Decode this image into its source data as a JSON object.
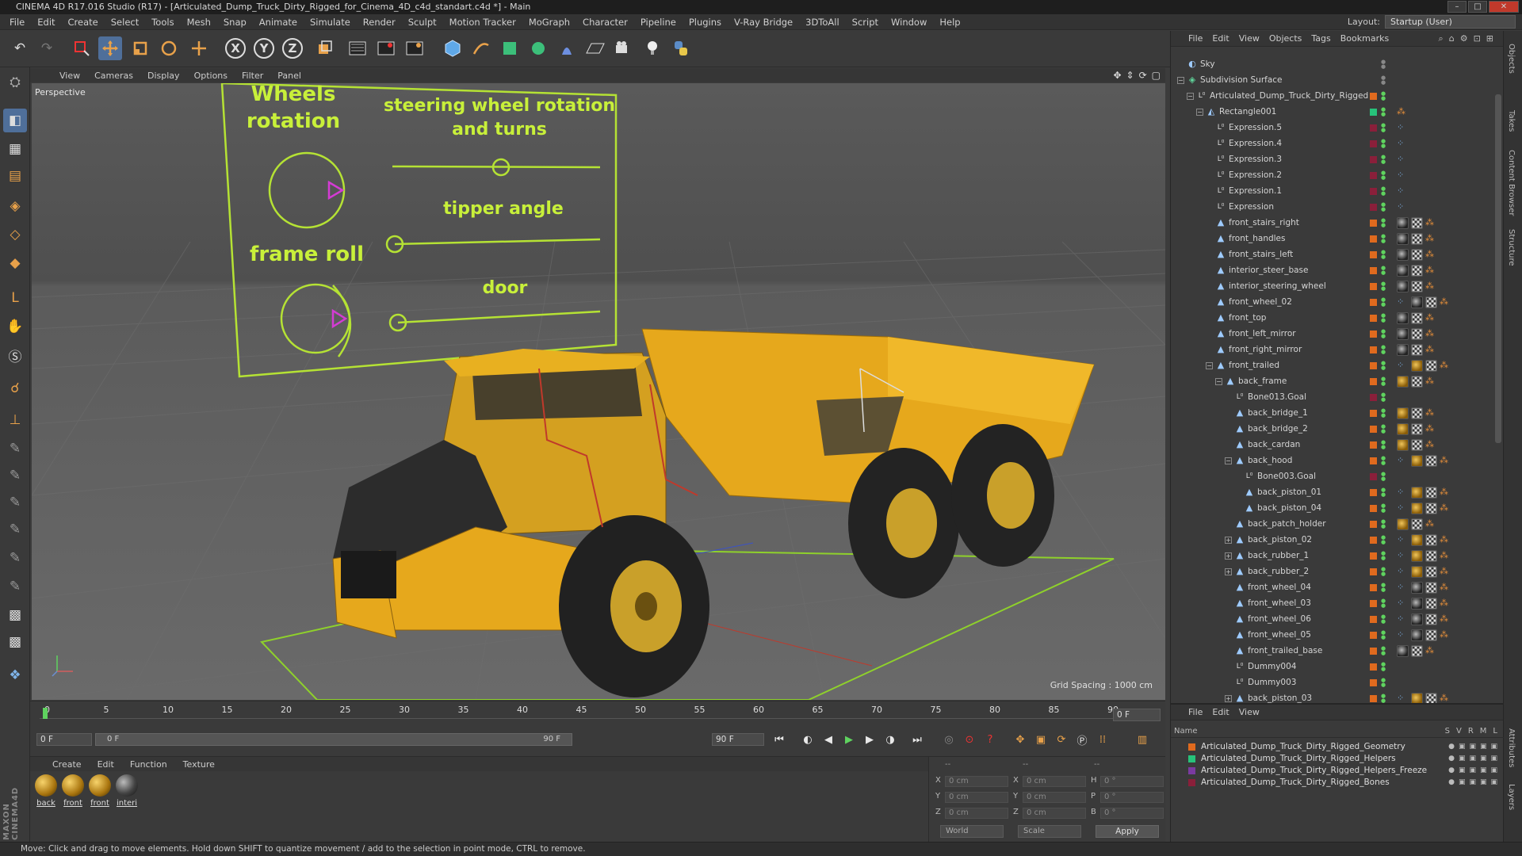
{
  "window": {
    "title": "CINEMA 4D R17.016 Studio (R17) - [Articulated_Dump_Truck_Dirty_Rigged_for_Cinema_4D_c4d_standart.c4d *] - Main",
    "layout_label": "Layout:",
    "layout_value": "Startup (User)"
  },
  "menubar": [
    "File",
    "Edit",
    "Create",
    "Select",
    "Tools",
    "Mesh",
    "Snap",
    "Animate",
    "Simulate",
    "Render",
    "Sculpt",
    "Motion Tracker",
    "MoGraph",
    "Character",
    "Pipeline",
    "Plugins",
    "V-Ray Bridge",
    "3DToAll",
    "Script",
    "Window",
    "Help"
  ],
  "viewport": {
    "menu": [
      "View",
      "Cameras",
      "Display",
      "Options",
      "Filter",
      "Panel"
    ],
    "label": "Perspective",
    "grid_spacing": "Grid Spacing : 1000 cm",
    "rig_labels": {
      "wheels": "Wheels",
      "rotation": "rotation",
      "steering1": "steering wheel rotation",
      "steering2": "and turns",
      "tipper": "tipper angle",
      "frame_roll": "frame roll",
      "door": "door"
    }
  },
  "timeline": {
    "ticks": [
      "0",
      "5",
      "10",
      "15",
      "20",
      "25",
      "30",
      "35",
      "40",
      "45",
      "50",
      "55",
      "60",
      "65",
      "70",
      "75",
      "80",
      "85",
      "90"
    ],
    "current_frame": "0 F",
    "start_field": "0 F",
    "range_start": "0 F",
    "range_end": "90 F",
    "end_field": "90 F"
  },
  "materials": {
    "menu": [
      "Create",
      "Edit",
      "Function",
      "Texture"
    ],
    "items": [
      {
        "label": "back",
        "style": "gold"
      },
      {
        "label": "front",
        "style": "gold"
      },
      {
        "label": "front",
        "style": "gold"
      },
      {
        "label": "interi",
        "style": "dark"
      }
    ]
  },
  "coordinates": {
    "header1": "--",
    "header2": "--",
    "header3": "--",
    "rows": [
      {
        "a_label": "X",
        "a_val": "0 cm",
        "b_label": "X",
        "b_val": "0 cm",
        "c_label": "H",
        "c_val": "0 °"
      },
      {
        "a_label": "Y",
        "a_val": "0 cm",
        "b_label": "Y",
        "b_val": "0 cm",
        "c_label": "P",
        "c_val": "0 °"
      },
      {
        "a_label": "Z",
        "a_val": "0 cm",
        "b_label": "Z",
        "b_val": "0 cm",
        "c_label": "B",
        "c_val": "0 °"
      }
    ],
    "world": "World",
    "scale": "Scale",
    "apply": "Apply"
  },
  "status": "Move: Click and drag to move elements. Hold down SHIFT to quantize movement / add to the selection in point mode, CTRL to remove.",
  "object_manager": {
    "menu": [
      "File",
      "Edit",
      "View",
      "Objects",
      "Tags",
      "Bookmarks"
    ],
    "rows": [
      {
        "name": "Sky",
        "icon": "sky-icon",
        "depth": 0,
        "expand": "",
        "color": "",
        "tags": []
      },
      {
        "name": "Subdivision Surface",
        "icon": "subdivision-icon",
        "depth": 0,
        "expand": "-",
        "color": "",
        "tags": []
      },
      {
        "name": "Articulated_Dump_Truck_Dirty_Rigged",
        "icon": "null-icon",
        "depth": 1,
        "expand": "-",
        "color": "#e06a1e",
        "tags": []
      },
      {
        "name": "Rectangle001",
        "icon": "spline-icon",
        "depth": 2,
        "expand": "-",
        "color": "#27c27a",
        "tags": [
          "or"
        ]
      },
      {
        "name": "Expression.5",
        "icon": "null-icon",
        "depth": 3,
        "expand": "",
        "color": "#8a1f3a",
        "tags": [
          "xp"
        ]
      },
      {
        "name": "Expression.4",
        "icon": "null-icon",
        "depth": 3,
        "expand": "",
        "color": "#8a1f3a",
        "tags": [
          "xp"
        ]
      },
      {
        "name": "Expression.3",
        "icon": "null-icon",
        "depth": 3,
        "expand": "",
        "color": "#8a1f3a",
        "tags": [
          "xp"
        ]
      },
      {
        "name": "Expression.2",
        "icon": "null-icon",
        "depth": 3,
        "expand": "",
        "color": "#8a1f3a",
        "tags": [
          "xp"
        ]
      },
      {
        "name": "Expression.1",
        "icon": "null-icon",
        "depth": 3,
        "expand": "",
        "color": "#8a1f3a",
        "tags": [
          "xp"
        ]
      },
      {
        "name": "Expression",
        "icon": "null-icon",
        "depth": 3,
        "expand": "",
        "color": "#8a1f3a",
        "tags": [
          "xp"
        ]
      },
      {
        "name": "front_stairs_right",
        "icon": "polygon-icon",
        "depth": 3,
        "expand": "",
        "color": "#e06a1e",
        "tags": [
          "dk",
          "chk",
          "or"
        ]
      },
      {
        "name": "front_handles",
        "icon": "polygon-icon",
        "depth": 3,
        "expand": "",
        "color": "#e06a1e",
        "tags": [
          "dk",
          "chk",
          "or"
        ]
      },
      {
        "name": "front_stairs_left",
        "icon": "polygon-icon",
        "depth": 3,
        "expand": "",
        "color": "#e06a1e",
        "tags": [
          "dk",
          "chk",
          "or"
        ]
      },
      {
        "name": "interior_steer_base",
        "icon": "polygon-icon",
        "depth": 3,
        "expand": "",
        "color": "#e06a1e",
        "tags": [
          "dk",
          "chk",
          "or"
        ]
      },
      {
        "name": "interior_steering_wheel",
        "icon": "polygon-icon",
        "depth": 3,
        "expand": "",
        "color": "#e06a1e",
        "tags": [
          "dk",
          "chk",
          "or"
        ]
      },
      {
        "name": "front_wheel_02",
        "icon": "polygon-icon",
        "depth": 3,
        "expand": "",
        "color": "#e06a1e",
        "tags": [
          "xp",
          "dk",
          "chk",
          "or"
        ]
      },
      {
        "name": "front_top",
        "icon": "polygon-icon",
        "depth": 3,
        "expand": "",
        "color": "#e06a1e",
        "tags": [
          "dk",
          "chk",
          "or"
        ]
      },
      {
        "name": "front_left_mirror",
        "icon": "polygon-icon",
        "depth": 3,
        "expand": "",
        "color": "#e06a1e",
        "tags": [
          "dk",
          "chk",
          "or"
        ]
      },
      {
        "name": "front_right_mirror",
        "icon": "polygon-icon",
        "depth": 3,
        "expand": "",
        "color": "#e06a1e",
        "tags": [
          "dk",
          "chk",
          "or"
        ]
      },
      {
        "name": "front_trailed",
        "icon": "polygon-icon",
        "depth": 3,
        "expand": "-",
        "color": "#e06a1e",
        "tags": [
          "xp",
          "mat1",
          "chk",
          "or"
        ]
      },
      {
        "name": "back_frame",
        "icon": "polygon-icon",
        "depth": 4,
        "expand": "-",
        "color": "#e06a1e",
        "tags": [
          "mat1",
          "chk",
          "or"
        ]
      },
      {
        "name": "Bone013.Goal",
        "icon": "null-icon",
        "depth": 5,
        "expand": "",
        "color": "#8a1f3a",
        "tags": []
      },
      {
        "name": "back_bridge_1",
        "icon": "polygon-icon",
        "depth": 5,
        "expand": "",
        "color": "#e06a1e",
        "tags": [
          "mat1",
          "chk",
          "or"
        ]
      },
      {
        "name": "back_bridge_2",
        "icon": "polygon-icon",
        "depth": 5,
        "expand": "",
        "color": "#e06a1e",
        "tags": [
          "mat1",
          "chk",
          "or"
        ]
      },
      {
        "name": "back_cardan",
        "icon": "polygon-icon",
        "depth": 5,
        "expand": "",
        "color": "#e06a1e",
        "tags": [
          "mat1",
          "chk",
          "or"
        ]
      },
      {
        "name": "back_hood",
        "icon": "polygon-icon",
        "depth": 5,
        "expand": "-",
        "color": "#e06a1e",
        "tags": [
          "xp",
          "mat1",
          "chk",
          "or"
        ]
      },
      {
        "name": "Bone003.Goal",
        "icon": "null-icon",
        "depth": 6,
        "expand": "",
        "color": "#8a1f3a",
        "tags": []
      },
      {
        "name": "back_piston_01",
        "icon": "polygon-icon",
        "depth": 6,
        "expand": "",
        "color": "#e06a1e",
        "tags": [
          "xp",
          "mat1",
          "chk",
          "or"
        ]
      },
      {
        "name": "back_piston_04",
        "icon": "polygon-icon",
        "depth": 6,
        "expand": "",
        "color": "#e06a1e",
        "tags": [
          "xp",
          "mat1",
          "chk",
          "or"
        ]
      },
      {
        "name": "back_patch_holder",
        "icon": "polygon-icon",
        "depth": 5,
        "expand": "",
        "color": "#e06a1e",
        "tags": [
          "mat1",
          "chk",
          "or"
        ]
      },
      {
        "name": "back_piston_02",
        "icon": "polygon-icon",
        "depth": 5,
        "expand": "+",
        "color": "#e06a1e",
        "tags": [
          "xp",
          "mat1",
          "chk",
          "or"
        ]
      },
      {
        "name": "back_rubber_1",
        "icon": "polygon-icon",
        "depth": 5,
        "expand": "+",
        "color": "#e06a1e",
        "tags": [
          "xp",
          "mat1",
          "chk",
          "or"
        ]
      },
      {
        "name": "back_rubber_2",
        "icon": "polygon-icon",
        "depth": 5,
        "expand": "+",
        "color": "#e06a1e",
        "tags": [
          "xp",
          "mat1",
          "chk",
          "or"
        ]
      },
      {
        "name": "front_wheel_04",
        "icon": "polygon-icon",
        "depth": 5,
        "expand": "",
        "color": "#e06a1e",
        "tags": [
          "xp",
          "dk",
          "chk",
          "or"
        ]
      },
      {
        "name": "front_wheel_03",
        "icon": "polygon-icon",
        "depth": 5,
        "expand": "",
        "color": "#e06a1e",
        "tags": [
          "xp",
          "dk",
          "chk",
          "or"
        ]
      },
      {
        "name": "front_wheel_06",
        "icon": "polygon-icon",
        "depth": 5,
        "expand": "",
        "color": "#e06a1e",
        "tags": [
          "xp",
          "dk",
          "chk",
          "or"
        ]
      },
      {
        "name": "front_wheel_05",
        "icon": "polygon-icon",
        "depth": 5,
        "expand": "",
        "color": "#e06a1e",
        "tags": [
          "xp",
          "dk",
          "chk",
          "or"
        ]
      },
      {
        "name": "front_trailed_base",
        "icon": "polygon-icon",
        "depth": 5,
        "expand": "",
        "color": "#e06a1e",
        "tags": [
          "dk",
          "chk",
          "or"
        ]
      },
      {
        "name": "Dummy004",
        "icon": "null-icon",
        "depth": 5,
        "expand": "",
        "color": "#e06a1e",
        "tags": []
      },
      {
        "name": "Dummy003",
        "icon": "null-icon",
        "depth": 5,
        "expand": "",
        "color": "#e06a1e",
        "tags": []
      },
      {
        "name": "back_piston_03",
        "icon": "polygon-icon",
        "depth": 5,
        "expand": "+",
        "color": "#e06a1e",
        "tags": [
          "xp",
          "mat1",
          "chk",
          "or"
        ]
      }
    ]
  },
  "layers": {
    "menu": [
      "File",
      "Edit",
      "View"
    ],
    "header_name": "Name",
    "header_cols": [
      "S",
      "V",
      "R",
      "M",
      "L"
    ],
    "rows": [
      {
        "name": "Articulated_Dump_Truck_Dirty_Rigged_Geometry",
        "color": "#e06a1e"
      },
      {
        "name": "Articulated_Dump_Truck_Dirty_Rigged_Helpers",
        "color": "#27c27a"
      },
      {
        "name": "Articulated_Dump_Truck_Dirty_Rigged_Helpers_Freeze",
        "color": "#7a3aa0"
      },
      {
        "name": "Articulated_Dump_Truck_Dirty_Rigged_Bones",
        "color": "#8a1f3a"
      }
    ]
  },
  "side_tabs": [
    "Objects",
    "Takes",
    "Content Browser",
    "Structure",
    "Attributes",
    "Layers"
  ]
}
